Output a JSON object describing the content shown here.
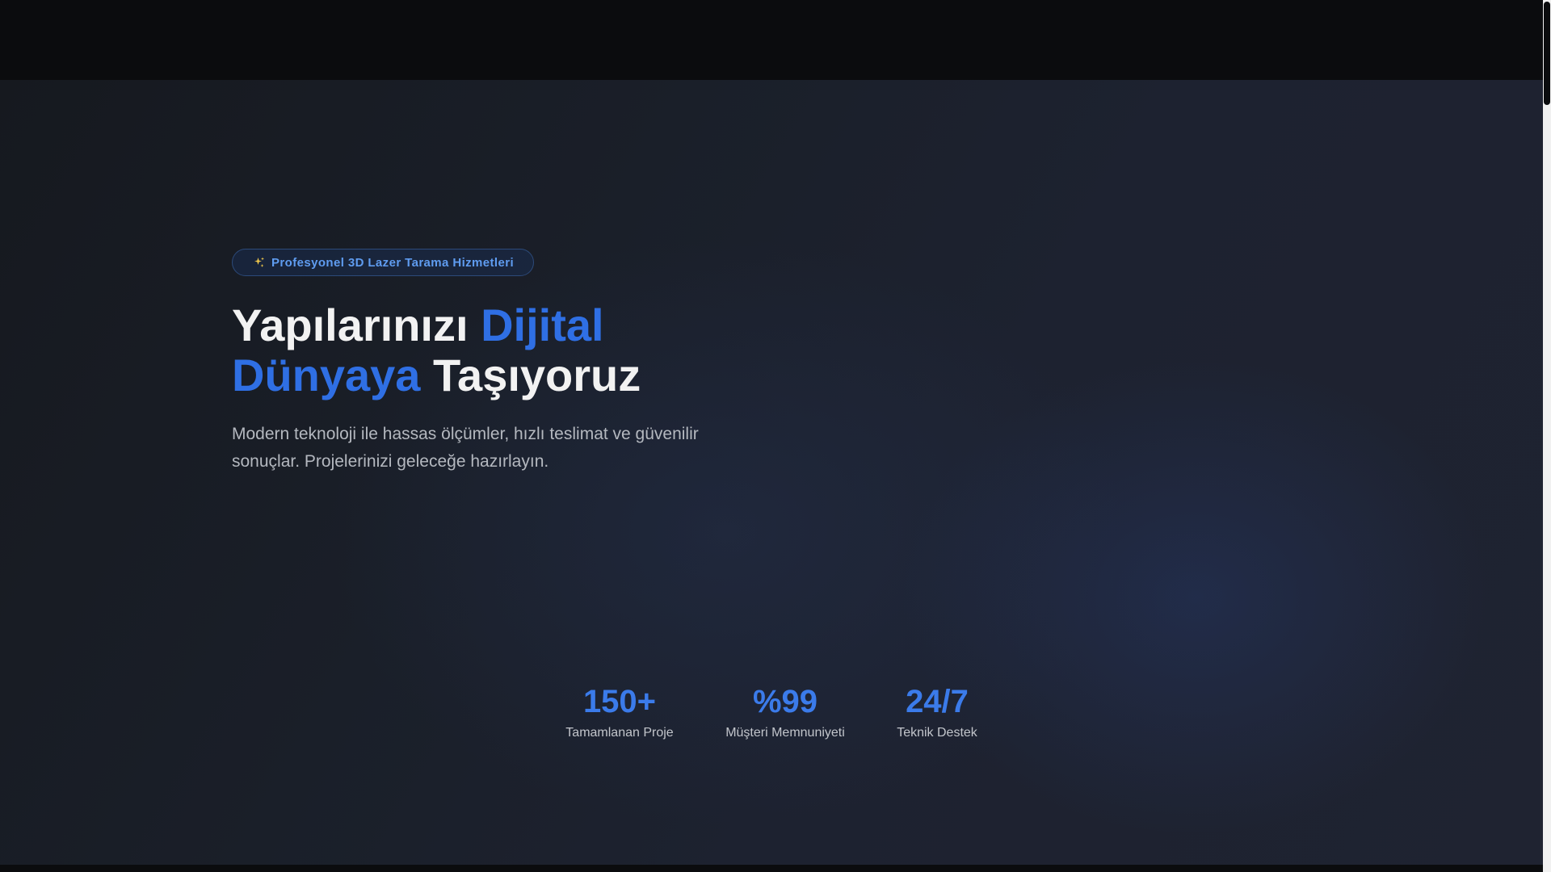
{
  "hero": {
    "badge": {
      "icon": "sparkles-icon",
      "icon_color": "#f2c94c",
      "text": "Profesyonel 3D Lazer Tarama Hizmetleri"
    },
    "headline": {
      "part1": "Yapılarınızı ",
      "accent1": "Dijital",
      "accent2": "Dünyaya",
      "part2": " Taşıyoruz"
    },
    "subtitle": "Modern teknoloji ile hassas ölçümler, hızlı teslimat ve güvenilir sonuçlar. Projelerinizi geleceğe hazırlayın."
  },
  "stats": [
    {
      "value": "150+",
      "label": "Tamamlanan Proje"
    },
    {
      "value": "%99",
      "label": "Müşteri Memnuniyeti"
    },
    {
      "value": "24/7",
      "label": "Teknik Destek"
    }
  ],
  "colors": {
    "accent": "#2f6fe4",
    "stat_accent": "#3b7bea",
    "badge_text": "#5f9cf0",
    "background": "#0b0c0e"
  }
}
